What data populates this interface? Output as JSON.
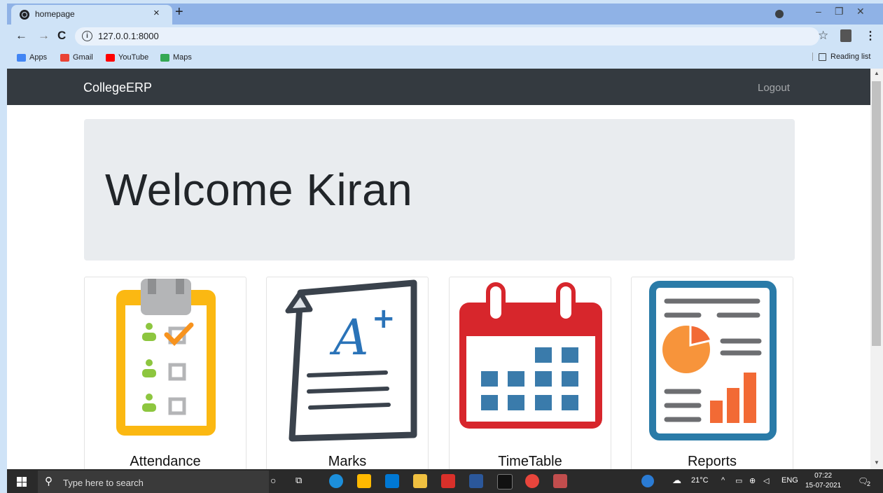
{
  "browser": {
    "tab_title": "homepage",
    "tab_close": "×",
    "new_tab": "+",
    "url": "127.0.0.1:8000",
    "bookmarks": [
      {
        "label": "Apps",
        "color": "#4285f4"
      },
      {
        "label": "Gmail",
        "color": "#ea4335"
      },
      {
        "label": "YouTube",
        "color": "#ff0000"
      },
      {
        "label": "Maps",
        "color": "#34a853"
      }
    ],
    "reading_list": "Reading list"
  },
  "page": {
    "brand": "CollegeERP",
    "logout": "Logout",
    "welcome": "Welcome Kiran",
    "cards": [
      {
        "label": "Attendance",
        "icon": "attendance-clipboard-icon"
      },
      {
        "label": "Marks",
        "icon": "marks-grade-paper-icon"
      },
      {
        "label": "TimeTable",
        "icon": "calendar-icon"
      },
      {
        "label": "Reports",
        "icon": "report-chart-icon"
      }
    ]
  },
  "taskbar": {
    "search_placeholder": "Type here to search",
    "weather": "21°C",
    "language": "ENG",
    "time": "07:22",
    "date": "15-07-2021",
    "notifications": "2"
  },
  "colors": {
    "navbar": "#343a40",
    "jumbotron": "#e9ecef",
    "attendance_yellow": "#fbb812",
    "calendar_red": "#d7262c",
    "calendar_blue": "#3a7bab",
    "report_blue": "#2a7ba8",
    "report_orange": "#f26a35"
  }
}
